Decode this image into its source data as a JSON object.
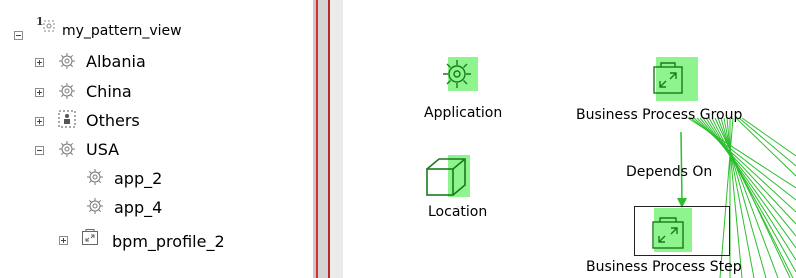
{
  "tree": {
    "root": {
      "label": "my_pattern_view",
      "badge": "1",
      "icon": "pattern-view-icon",
      "expanded": true
    },
    "items": [
      {
        "label": "Albania",
        "icon": "gear-icon",
        "expanded": false
      },
      {
        "label": "China",
        "icon": "gear-icon",
        "expanded": false
      },
      {
        "label": "Others",
        "icon": "group-icon",
        "expanded": false
      },
      {
        "label": "USA",
        "icon": "gear-icon",
        "expanded": true
      },
      {
        "label": "app_2",
        "icon": "gear-icon"
      },
      {
        "label": "app_4",
        "icon": "gear-icon"
      },
      {
        "label": "bpm_profile_2",
        "icon": "business-process-icon",
        "expanded": false
      }
    ]
  },
  "canvas": {
    "nodes": [
      {
        "label": "Application",
        "icon": "gear-icon"
      },
      {
        "label": "Business Process Group",
        "icon": "business-process-group-icon"
      },
      {
        "label": "Location",
        "icon": "cube-icon"
      },
      {
        "label": "Business Process Step",
        "icon": "business-process-step-icon",
        "selected": true
      }
    ],
    "edge_label": "Depends On"
  },
  "colors": {
    "highlight": "#8ef58e",
    "edge": "#2bbf2b",
    "splitter_red": "#d62f2f",
    "icon_gray": "#7a7a7a"
  }
}
